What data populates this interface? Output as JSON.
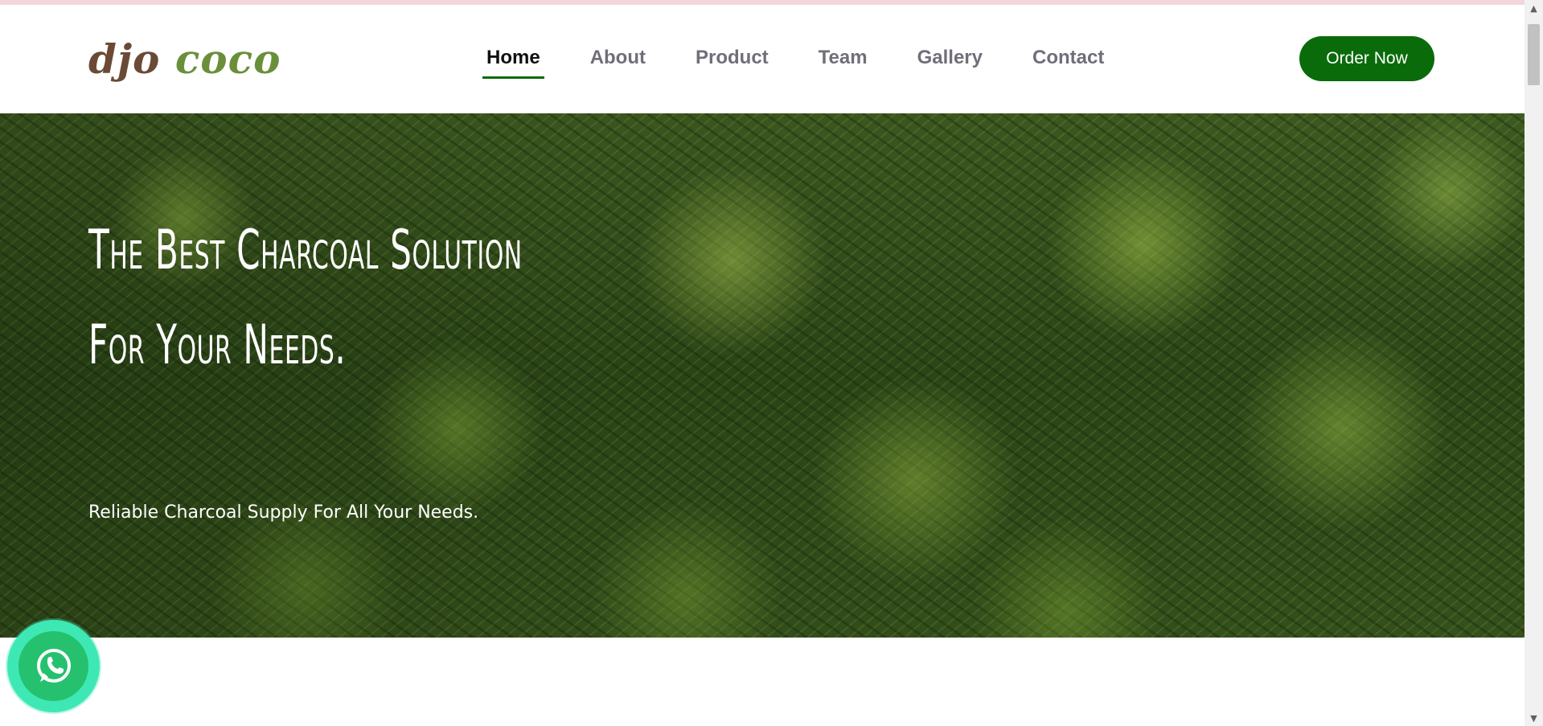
{
  "header": {
    "logo_part1": "djo",
    "logo_part2": "coco",
    "nav": [
      {
        "label": "Home",
        "active": true
      },
      {
        "label": "About"
      },
      {
        "label": "Product"
      },
      {
        "label": "Team"
      },
      {
        "label": "Gallery"
      },
      {
        "label": "Contact"
      }
    ],
    "cta_label": "Order Now"
  },
  "hero": {
    "title": "The Best Charcoal Solution For Your Needs.",
    "subtitle": "Reliable Charcoal Supply For All Your Needs."
  },
  "floating": {
    "icon": "whatsapp-icon"
  },
  "colors": {
    "brand_green": "#0a6b0a",
    "logo_brown": "#6b4a35",
    "logo_green": "#6a8f3a",
    "whatsapp_outer": "#3ee8b5",
    "whatsapp_inner": "#25c16e"
  },
  "scrollbar": {
    "up_arrow": "▲",
    "down_arrow": "▼"
  }
}
